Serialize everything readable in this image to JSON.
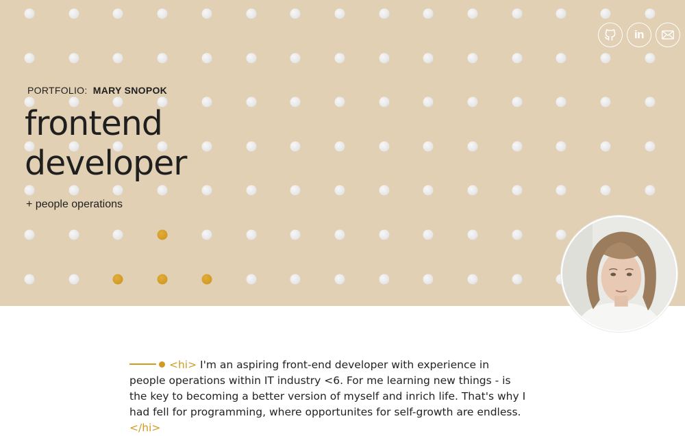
{
  "hero": {
    "portfolio_label": "PORTFOLIO:",
    "name": "MARY SNOPOK",
    "title_line1": "frontend",
    "title_line2": "developer",
    "subtitle": "+ people operations"
  },
  "social": [
    {
      "name": "github",
      "icon": "github-icon",
      "label": "GitHub"
    },
    {
      "name": "linkedin",
      "icon": "linkedin-icon",
      "label": "in"
    },
    {
      "name": "email",
      "icon": "mail-icon",
      "label": "Email"
    }
  ],
  "avatar": {
    "alt": "Portrait of Mary Snopok"
  },
  "intro": {
    "open_tag": "<hi>",
    "text": "I'm an aspiring front-end developer with experience in people operations within IT industry <6. For me learning new things - is the key to becoming a better version of myself and inrich life. That's why I had fell for programming, where opportunites for self-growth are endless.",
    "close_tag": "</hi>"
  },
  "colors": {
    "hero_bg": "#e1d0b4",
    "accent": "#d29a22",
    "dot": "#e8e8e8",
    "text": "#1f1f1f"
  }
}
